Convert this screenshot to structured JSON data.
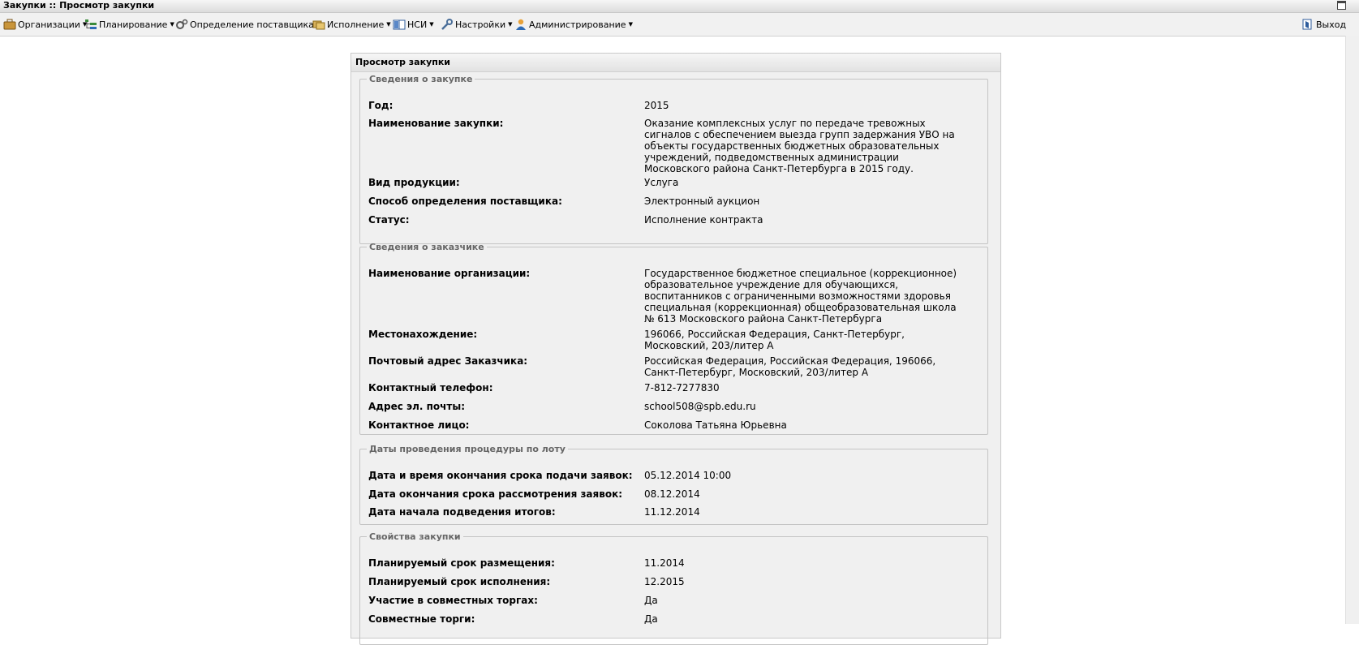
{
  "window": {
    "title": "Закупки :: Просмотр закупки"
  },
  "menu": {
    "items": [
      {
        "key": "orgs",
        "label": "Организации",
        "icon": "briefcase-icon"
      },
      {
        "key": "plan",
        "label": "Планирование",
        "icon": "tree-list-icon"
      },
      {
        "key": "supplier",
        "label": "Определение поставщика",
        "icon": "gears-icon"
      },
      {
        "key": "exec",
        "label": "Исполнение",
        "icon": "folders-icon"
      },
      {
        "key": "nsi",
        "label": "НСИ",
        "icon": "book-icon"
      },
      {
        "key": "settings",
        "label": "Настройки",
        "icon": "wrench-icon"
      },
      {
        "key": "admin",
        "label": "Администрирование",
        "icon": "user-icon"
      }
    ],
    "exit_label": "Выход"
  },
  "panel": {
    "title": "Просмотр закупки"
  },
  "sections": {
    "purchase": {
      "legend": "Сведения о закупке",
      "year_label": "Год:",
      "year": "2015",
      "name_label": "Наименование закупки:",
      "name": "Оказание комплексных услуг по передаче тревожных сигналов с обеспечением выезда групп задержания УВО на объекты государственных бюджетных образовательных учреждений, подведомственных администрации Московского района Санкт-Петербурга в 2015 году.",
      "product_label": "Вид продукции:",
      "product": "Услуга",
      "method_label": "Способ определения поставщика:",
      "method": "Электронный аукцион",
      "status_label": "Статус:",
      "status": "Исполнение контракта"
    },
    "customer": {
      "legend": "Сведения о заказчике",
      "org_label": "Наименование организации:",
      "org": "Государственное бюджетное специальное (коррекционное) образовательное учреждение для обучающихся, воспитанников с ограниченными возможностями здоровья специальная (коррекционная) общеобразовательная школа № 613 Московского района Санкт-Петербурга",
      "location_label": "Местонахождение:",
      "location": "196066, Российская Федерация, Санкт-Петербург, Московский, 203/литер А",
      "postal_label": "Почтовый адрес Заказчика:",
      "postal": "Российская Федерация, Российская Федерация, 196066, Санкт-Петербург, Московский, 203/литер А",
      "phone_label": "Контактный телефон:",
      "phone": "7-812-7277830",
      "email_label": "Адрес эл. почты:",
      "email": "school508@spb.edu.ru",
      "contact_label": "Контактное лицо:",
      "contact": "Соколова Татьяна Юрьевна"
    },
    "dates": {
      "legend": "Даты проведения процедуры по лоту",
      "end_label": "Дата и время окончания срока подачи заявок:",
      "end": "05.12.2014 10:00",
      "review_label": "Дата окончания срока рассмотрения заявок:",
      "review": "08.12.2014",
      "results_label": "Дата начала подведения итогов:",
      "results": "11.12.2014"
    },
    "props": {
      "legend": "Свойства закупки",
      "place_label": "Планируемый срок размещения:",
      "place": "11.2014",
      "exec_label": "Планируемый срок исполнения:",
      "exec": "12.2015",
      "joint_label": "Участие в совместных торгах:",
      "joint": "Да",
      "joint2_label": "Совместные торги:",
      "joint2": "Да"
    }
  }
}
